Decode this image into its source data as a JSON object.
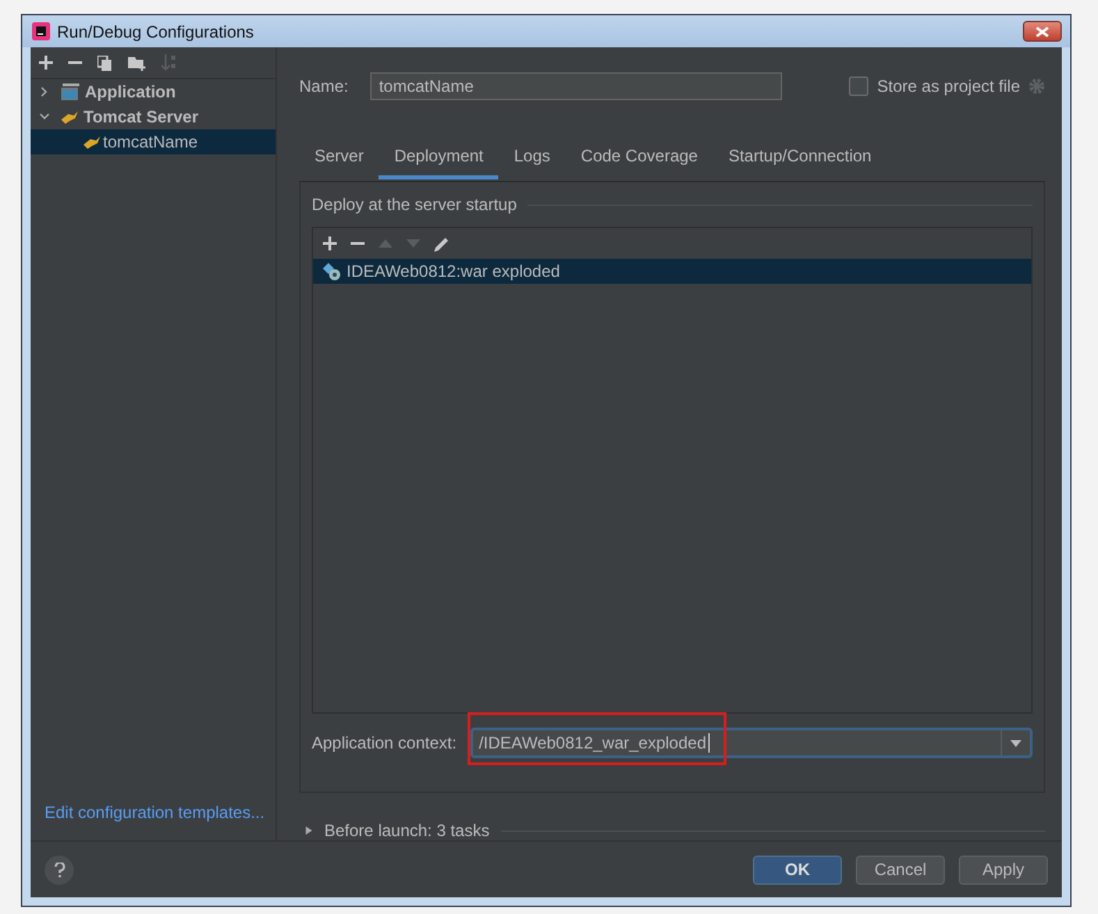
{
  "window": {
    "title": "Run/Debug Configurations"
  },
  "tree": [
    {
      "label": "Application",
      "kind": "application",
      "expanded": false,
      "selected": false
    },
    {
      "label": "Tomcat Server",
      "kind": "tomcat",
      "expanded": true,
      "selected": false,
      "children": [
        {
          "label": "tomcatName",
          "kind": "tomcat",
          "selected": true
        }
      ]
    }
  ],
  "edit_templates_link": "Edit configuration templates...",
  "name_field": {
    "label": "Name:",
    "value": "tomcatName"
  },
  "store_as_project_file": {
    "label": "Store as project file",
    "checked": false
  },
  "tabs": [
    {
      "label": "Server",
      "selected": false
    },
    {
      "label": "Deployment",
      "selected": true
    },
    {
      "label": "Logs",
      "selected": false
    },
    {
      "label": "Code Coverage",
      "selected": false
    },
    {
      "label": "Startup/Connection",
      "selected": false
    }
  ],
  "deploy_section": {
    "title": "Deploy at the server startup",
    "artifacts": [
      {
        "label": "IDEAWeb0812:war exploded",
        "selected": true
      }
    ]
  },
  "application_context": {
    "label": "Application context:",
    "value": "/IDEAWeb0812_war_exploded"
  },
  "before_launch": {
    "label": "Before launch: 3 tasks",
    "expanded": false
  },
  "buttons": [
    {
      "label": "OK",
      "kind": "primary"
    },
    {
      "label": "Cancel",
      "kind": "normal"
    },
    {
      "label": "Apply",
      "kind": "normal"
    }
  ]
}
